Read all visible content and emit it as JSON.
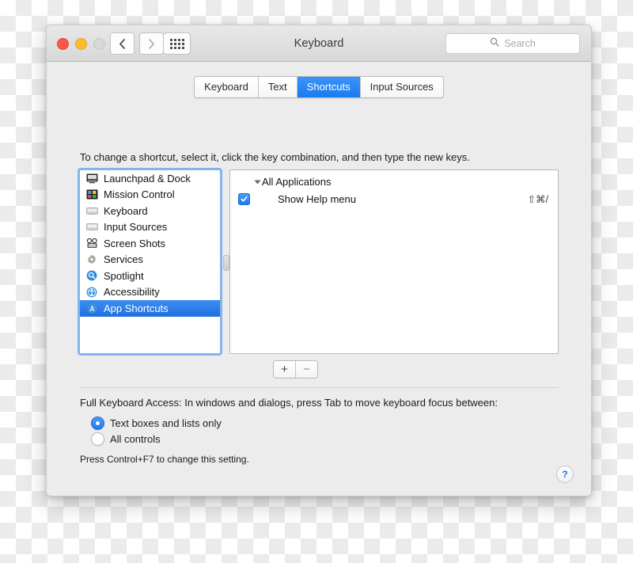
{
  "window": {
    "title": "Keyboard",
    "traffic_lights": [
      "close",
      "minimize",
      "zoom"
    ],
    "back_label": "Back",
    "forward_label": "Forward",
    "showall_label": "Show All",
    "search": {
      "placeholder": "Search",
      "value": ""
    }
  },
  "tabs": [
    {
      "label": "Keyboard",
      "active": false
    },
    {
      "label": "Text",
      "active": false
    },
    {
      "label": "Shortcuts",
      "active": true
    },
    {
      "label": "Input Sources",
      "active": false
    }
  ],
  "instruction": "To change a shortcut, select it, click the key combination, and then type the new keys.",
  "sidebar": {
    "items": [
      {
        "label": "Launchpad & Dock",
        "icon": "launchpad-dock-icon",
        "selected": false
      },
      {
        "label": "Mission Control",
        "icon": "mission-control-icon",
        "selected": false
      },
      {
        "label": "Keyboard",
        "icon": "keyboard-icon",
        "selected": false
      },
      {
        "label": "Input Sources",
        "icon": "input-sources-icon",
        "selected": false
      },
      {
        "label": "Screen Shots",
        "icon": "screen-shots-icon",
        "selected": false
      },
      {
        "label": "Services",
        "icon": "services-gear-icon",
        "selected": false
      },
      {
        "label": "Spotlight",
        "icon": "spotlight-icon",
        "selected": false
      },
      {
        "label": "Accessibility",
        "icon": "accessibility-icon",
        "selected": false
      },
      {
        "label": "App Shortcuts",
        "icon": "app-shortcuts-icon",
        "selected": true
      }
    ]
  },
  "shortcut_list": {
    "group_label": "All Applications",
    "rows": [
      {
        "label": "Show Help menu",
        "combo": "⇧⌘/",
        "checked": true
      }
    ]
  },
  "list_buttons": {
    "add": "+",
    "remove": "−"
  },
  "full_keyboard_access": {
    "title": "Full Keyboard Access: In windows and dialogs, press Tab to move keyboard focus between:",
    "options": [
      {
        "label": "Text boxes and lists only",
        "selected": true
      },
      {
        "label": "All controls",
        "selected": false
      }
    ],
    "hint": "Press Control+F7 to change this setting."
  },
  "help_button": {
    "label": "?"
  },
  "colors": {
    "accent_blue": "#1e79ef",
    "selection_blue": "#2b7ce8",
    "window_bg": "#ececec",
    "help_blue": "#2b6fd4"
  }
}
